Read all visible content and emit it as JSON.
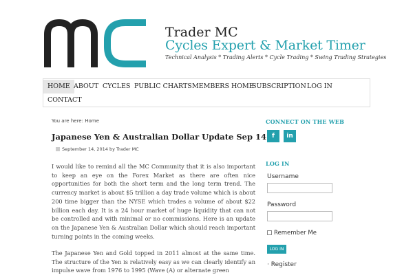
{
  "header": {
    "title": "Trader MC",
    "subtitle": "Cycles Expert & Market Timer",
    "tagline": "Technical Analysis * Trading Alerts * Cycle Trading * Swing Trading Strategies"
  },
  "nav": {
    "items": [
      {
        "label": "HOME",
        "active": true
      },
      {
        "label": "ABOUT"
      },
      {
        "label": "CYCLES"
      },
      {
        "label": "PUBLIC CHARTS"
      },
      {
        "label": "MEMBERS HOME"
      },
      {
        "label": "SUBSCRIPTION"
      },
      {
        "label": "LOG IN"
      },
      {
        "label": "CONTACT"
      }
    ]
  },
  "breadcrumb": {
    "prefix": "You are here: ",
    "link": "Home"
  },
  "post": {
    "title": "Japanese Yen & Australian Dollar Update Sep 14",
    "meta": "September 14, 2014 by Trader MC",
    "paragraphs": [
      "I would like to remind all the MC Community that it is also important to keep an eye on the Forex Market as there are often nice opportunities for both the short term and the long term trend. The currency market is about $5 trillion a day trade volume which is about 200 time bigger than the NYSE which trades a volume of about $22 billion each day. It is a 24 hour market of huge liquidity that can not be controlled and with minimal or no commissions. Here is an update on the Japanese Yen & Australian Dollar which should reach important turning points in the coming weeks.",
      "The Japanese Yen and Gold topped in 2011 almost at the same time. The structure of the Yen is relatively easy as we can clearly identify an impulse wave from 1976 to 1995 (Wave (A) or alternate green"
    ]
  },
  "sidebar": {
    "connect_title": "CONNECT ON THE WEB",
    "social": [
      {
        "icon": "facebook-icon",
        "glyph": "f"
      },
      {
        "icon": "linkedin-icon",
        "glyph": "in"
      }
    ],
    "login_title": "LOG IN",
    "username_label": "Username",
    "username_value": "",
    "password_label": "Password",
    "password_value": "",
    "remember_label": "Remember Me",
    "login_button": "LOG IN",
    "register_link": "Register"
  },
  "colors": {
    "accent": "#23a0ad",
    "logo_dark": "#222222"
  }
}
